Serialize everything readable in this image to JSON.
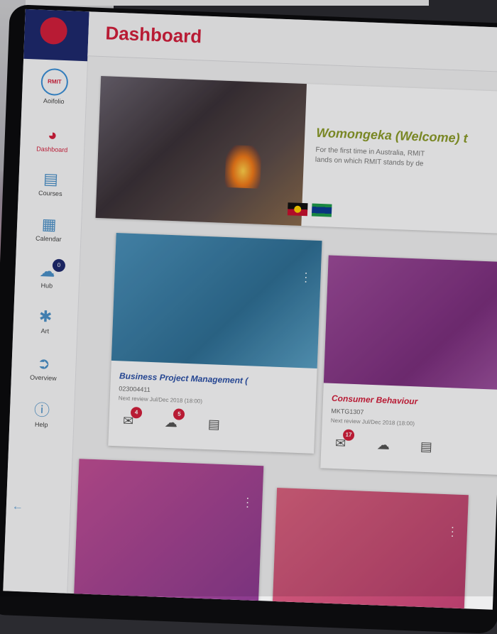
{
  "app": {
    "title": "Dashboard",
    "brand_color": "#d21f3c",
    "nav_color": "#1e2a6e"
  },
  "sidebar": {
    "items": [
      {
        "label": "Aoifolio",
        "icon": "profile-badge-icon"
      },
      {
        "label": "Dashboard",
        "icon": "dashboard-gauge-icon",
        "active": true
      },
      {
        "label": "Courses",
        "icon": "courses-book-icon"
      },
      {
        "label": "Calendar",
        "icon": "calendar-icon"
      },
      {
        "label": "Hub",
        "icon": "hub-chat-icon",
        "badge": "0"
      },
      {
        "label": "Art",
        "icon": "art-figure-icon"
      },
      {
        "label": "Overview",
        "icon": "overview-arrow-icon"
      },
      {
        "label": "Help",
        "icon": "help-icon"
      }
    ]
  },
  "welcome": {
    "heading": "Womongeka (Welcome) t",
    "body_line1": "For the first time in Australia, RMIT",
    "body_line2": "lands on which RMIT stands by de"
  },
  "courses": [
    {
      "title": "Business Project Management (",
      "code": "023004411",
      "date": "Next review Jul/Dec 2018 (18:00)",
      "feedback_badge": "4",
      "chat_badge": "5",
      "image_color": "#3d7fa6"
    },
    {
      "title": "Consumer Behaviour",
      "code": "MKTG1307",
      "date": "Next review Jul/Dec 2018 (18:00)",
      "feedback_badge": "17",
      "chat_badge": "",
      "image_color": "#8a3f8a"
    }
  ],
  "bottom_cards": [
    {
      "image_color": "#b4478f"
    },
    {
      "image_color": "#c8537d"
    }
  ]
}
